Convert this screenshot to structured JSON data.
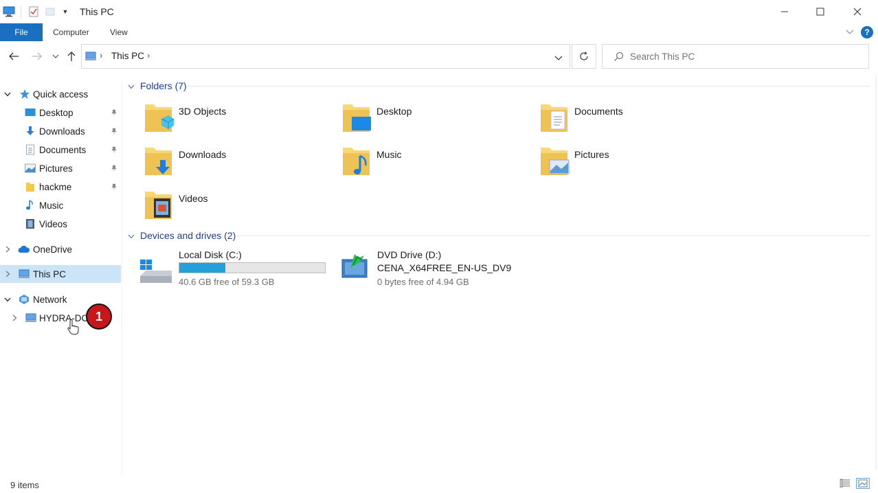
{
  "window": {
    "title": "This PC",
    "minimize_glyph": "—",
    "maximize_glyph": "☐",
    "close_glyph": "✕"
  },
  "ribbon": {
    "tabs": [
      {
        "label": "File",
        "active": true
      },
      {
        "label": "Computer",
        "active": false
      },
      {
        "label": "View",
        "active": false
      }
    ],
    "help_glyph": "?"
  },
  "address_bar": {
    "path": [
      "This PC"
    ],
    "separator": "›"
  },
  "search": {
    "placeholder": "Search This PC"
  },
  "sidebar": {
    "quick_access": {
      "label": "Quick access",
      "items": [
        {
          "label": "Desktop",
          "icon": "desktop-icon",
          "pinned": true
        },
        {
          "label": "Downloads",
          "icon": "downloads-icon",
          "pinned": true
        },
        {
          "label": "Documents",
          "icon": "documents-icon",
          "pinned": true
        },
        {
          "label": "Pictures",
          "icon": "pictures-icon",
          "pinned": true
        },
        {
          "label": "hackme",
          "icon": "folder-icon",
          "pinned": true
        },
        {
          "label": "Music",
          "icon": "music-icon",
          "pinned": false
        },
        {
          "label": "Videos",
          "icon": "videos-icon",
          "pinned": false
        }
      ]
    },
    "onedrive": {
      "label": "OneDrive"
    },
    "this_pc": {
      "label": "This PC",
      "selected": true
    },
    "network": {
      "label": "Network",
      "children": [
        {
          "label": "HYDRA-DC"
        }
      ]
    }
  },
  "content": {
    "folders_header": "Folders (7)",
    "folders": [
      {
        "name": "3D Objects",
        "icon": "3d-objects-icon"
      },
      {
        "name": "Desktop",
        "icon": "desktop-folder-icon"
      },
      {
        "name": "Documents",
        "icon": "documents-folder-icon"
      },
      {
        "name": "Downloads",
        "icon": "downloads-folder-icon"
      },
      {
        "name": "Music",
        "icon": "music-folder-icon"
      },
      {
        "name": "Pictures",
        "icon": "pictures-folder-icon"
      },
      {
        "name": "Videos",
        "icon": "videos-folder-icon"
      }
    ],
    "drives_header": "Devices and drives (2)",
    "drives": [
      {
        "name": "Local Disk (C:)",
        "free": "40.6 GB free of 59.3 GB",
        "used_fraction": 0.315,
        "icon": "windows-disk-icon"
      },
      {
        "name": "DVD Drive (D:)",
        "volume": "CENA_X64FREE_EN-US_DV9",
        "free": "0 bytes free of 4.94 GB",
        "icon": "dvd-drive-icon"
      }
    ]
  },
  "status": {
    "item_count": "9 items"
  },
  "annotation": {
    "badge_number": "1"
  },
  "colors": {
    "accent": "#1a6fc0",
    "selected_bg": "#cce4f7",
    "group_header": "#1e3f8c",
    "drive_bar": "#26a0da",
    "badge": "#c8161d",
    "folder_yellow": "#f8d775"
  }
}
